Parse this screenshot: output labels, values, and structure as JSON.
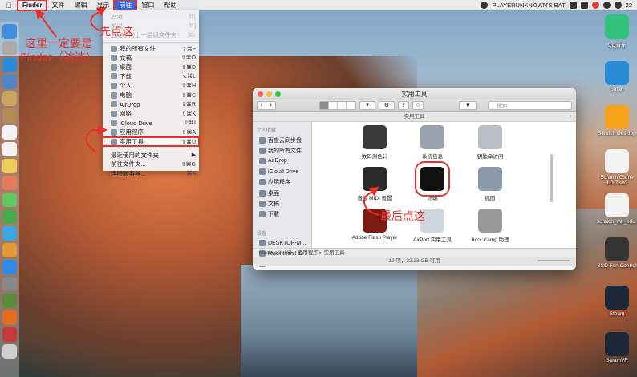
{
  "menubar": {
    "apple": "",
    "items": [
      "Finder",
      "文件",
      "编辑",
      "显示",
      "前往",
      "窗口",
      "帮助"
    ],
    "status_text": "PLAYERUNKNOWN'S BAT",
    "battery": "22"
  },
  "go_menu": {
    "items": [
      {
        "label": "后退",
        "shortcut": "⌘[",
        "disabled": true
      },
      {
        "label": "前进",
        "shortcut": "⌘]",
        "disabled": true
      },
      {
        "label": "选定项的上一层级文件夹",
        "shortcut": "⌘↑",
        "disabled": true
      },
      {
        "label": "我的所有文件",
        "shortcut": "⇧⌘F",
        "icon": true
      },
      {
        "label": "文稿",
        "shortcut": "⇧⌘O",
        "icon": true
      },
      {
        "label": "桌面",
        "shortcut": "⇧⌘D",
        "icon": true
      },
      {
        "label": "下载",
        "shortcut": "⌥⌘L",
        "icon": true
      },
      {
        "label": "个人",
        "shortcut": "⇧⌘H",
        "icon": true
      },
      {
        "label": "电脑",
        "shortcut": "⇧⌘C",
        "icon": true
      },
      {
        "label": "AirDrop",
        "shortcut": "⇧⌘R",
        "icon": true
      },
      {
        "label": "网络",
        "shortcut": "⇧⌘K",
        "icon": true
      },
      {
        "label": "iCloud Drive",
        "shortcut": "⇧⌘I",
        "icon": true
      },
      {
        "label": "应用程序",
        "shortcut": "⇧⌘A",
        "icon": true
      },
      {
        "label": "实用工具",
        "shortcut": "⇧⌘U",
        "icon": true,
        "highlight": true
      },
      {
        "label": "最近使用的文件夹",
        "shortcut": "▶"
      },
      {
        "label": "前往文件夹...",
        "shortcut": "⇧⌘G"
      },
      {
        "label": "连接服务器...",
        "shortcut": "⌘K"
      }
    ]
  },
  "finder": {
    "title": "实用工具",
    "path_title": "实用工具",
    "plus": "+",
    "search_placeholder": "搜索",
    "sidebar": {
      "favorites_header": "个人收藏",
      "favorites": [
        "百度云同步盘",
        "我的所有文件",
        "AirDrop",
        "iCloud Drive",
        "应用程序",
        "桌面",
        "文稿",
        "下载"
      ],
      "devices_header": "设备",
      "devices": [
        "DESKTOP-M...",
        "Macintosh HD",
        "Hard Disk"
      ]
    },
    "items": [
      {
        "label": "数码测色计",
        "color": "#3a3a3a"
      },
      {
        "label": "系统信息",
        "color": "#9aa3ad"
      },
      {
        "label": "钥匙串访问",
        "color": "#b9bec4"
      },
      {
        "label": "音频 MIDI 设置",
        "color": "#2b2b2b"
      },
      {
        "label": "终端",
        "color": "#111111"
      },
      {
        "label": "抓图",
        "color": "#8a9aa8"
      },
      {
        "label": "Adobe Flash Player",
        "color": "#7a1a12"
      },
      {
        "label": "AirPort 实用工具",
        "color": "#cfd6de"
      },
      {
        "label": "Boot Camp 助理",
        "color": "#9a9a9a"
      }
    ],
    "pathbar": "Macintosh HD ▸ 应用程序 ▸ 实用工具",
    "status": "19 项，32.23 GB 可用"
  },
  "desktop_icons": [
    {
      "label": "QQ音乐",
      "color": "#31c27c"
    },
    {
      "label": "Safari",
      "color": "#2a8bd6"
    },
    {
      "label": "Scratch Desktop",
      "color": "#f7a21b"
    },
    {
      "label": "Scratch Game 1.0.7.sb3",
      "color": "#f2f2f2"
    },
    {
      "label": "scratch_mit_edu.html",
      "color": "#f2f2f2"
    },
    {
      "label": "SSD Fan Control",
      "color": "#333333"
    },
    {
      "label": "Steam",
      "color": "#1b2838"
    },
    {
      "label": "SteamVR",
      "color": "#1b2838"
    }
  ],
  "annotations": {
    "step1": "先点这",
    "finder_note": "这里一定要是Finder（访达）",
    "step3": "最后点这"
  },
  "colors": {
    "accent_red": "#e8302a",
    "menu_highlight": "#2f6ee5"
  }
}
